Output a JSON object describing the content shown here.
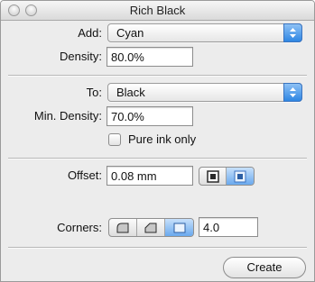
{
  "window": {
    "title": "Rich Black"
  },
  "add": {
    "label": "Add:",
    "value": "Cyan"
  },
  "density": {
    "label": "Density:",
    "value": "80.0%"
  },
  "to": {
    "label": "To:",
    "value": "Black"
  },
  "min_density": {
    "label": "Min. Density:",
    "value": "70.0%"
  },
  "pure_ink": {
    "label": "Pure ink only",
    "checked": false
  },
  "offset": {
    "label": "Offset:",
    "value": "0.08 mm",
    "selected_mode": 1
  },
  "corners": {
    "label": "Corners:",
    "value": "4.0",
    "selected_style": 2
  },
  "actions": {
    "create_label": "Create"
  },
  "colors": {
    "accent": "#3a86e6"
  }
}
